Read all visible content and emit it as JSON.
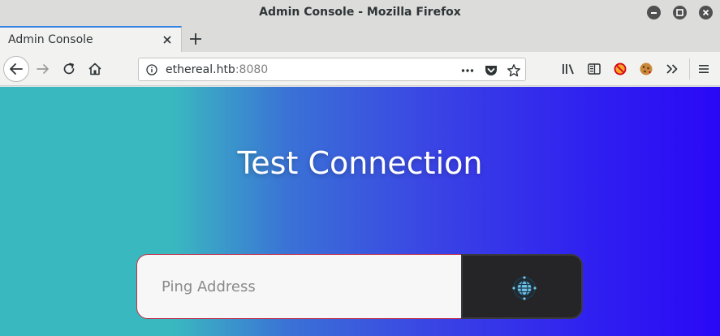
{
  "window": {
    "title": "Admin Console - Mozilla Firefox"
  },
  "tabs": [
    {
      "label": "Admin Console"
    }
  ],
  "urlbar": {
    "host": "ethereal.htb",
    "port": ":8080"
  },
  "page": {
    "heading": "Test Connection",
    "ping_input": {
      "placeholder": "Ping Address",
      "value": ""
    }
  },
  "colors": {
    "gradient_start": "#3ab8bf",
    "gradient_end": "#2a08f6",
    "button_bg": "#252527",
    "input_border": "#c0304a",
    "tab_accent": "#3584e4"
  },
  "icons": {
    "window_controls": [
      "minimize-icon",
      "maximize-icon",
      "close-icon"
    ],
    "toolbar": [
      "library-icon",
      "sidebar-icon",
      "blocked-extension-icon",
      "cookie-extension-icon",
      "overflow-chevrons-icon",
      "hamburger-menu-icon"
    ],
    "submit": "globe-icon"
  }
}
